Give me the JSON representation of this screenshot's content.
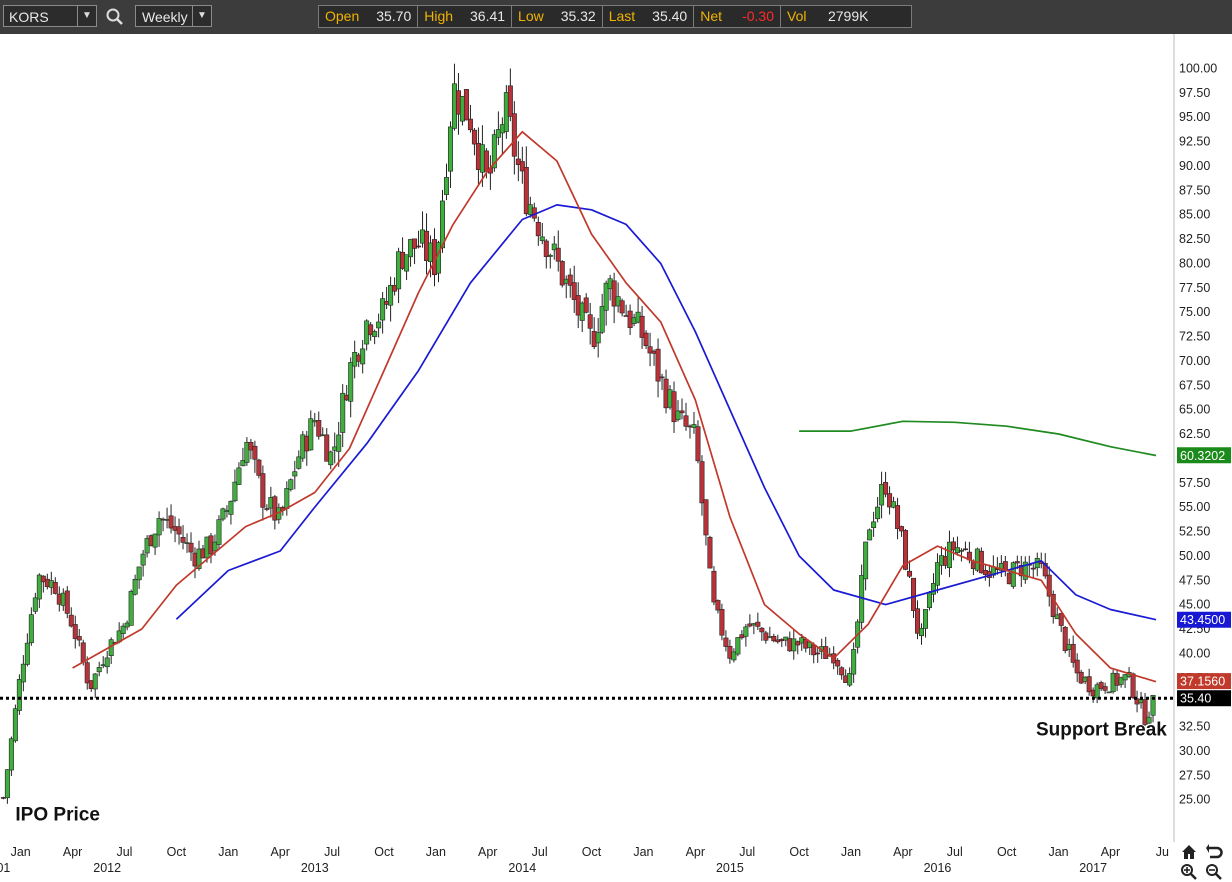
{
  "toolbar": {
    "symbol": "KORS",
    "interval": "Weekly",
    "quote": [
      {
        "label": "Open",
        "value": "35.70"
      },
      {
        "label": "High",
        "value": "36.41"
      },
      {
        "label": "Low",
        "value": "35.32"
      },
      {
        "label": "Last",
        "value": "35.40"
      },
      {
        "label": "Net",
        "value": "-0.30"
      },
      {
        "label": "Vol",
        "value": "2799K"
      }
    ],
    "net_color": "#ff2b2b"
  },
  "chart_data": {
    "type": "candlestick",
    "title": "",
    "ylim": [
      22.5,
      102.5
    ],
    "y_ticks": [
      "25.00",
      "27.50",
      "30.00",
      "32.50",
      "35.00",
      "37.50",
      "40.00",
      "42.50",
      "45.00",
      "47.50",
      "50.00",
      "52.50",
      "55.00",
      "57.50",
      "60.00",
      "62.50",
      "65.00",
      "67.50",
      "70.00",
      "72.50",
      "75.00",
      "77.50",
      "80.00",
      "82.50",
      "85.00",
      "87.50",
      "90.00",
      "92.50",
      "95.00",
      "97.50",
      "100.00"
    ],
    "x_axis_labels": [
      {
        "text": "Jan",
        "x": "2012-01"
      },
      {
        "text": "Apr",
        "x": "2012-04"
      },
      {
        "text": "Jul",
        "x": "2012-07"
      },
      {
        "text": "Oct",
        "x": "2012-10"
      },
      {
        "text": "Jan",
        "x": "2013-01"
      },
      {
        "text": "Apr",
        "x": "2013-04"
      },
      {
        "text": "Jul",
        "x": "2013-07"
      },
      {
        "text": "Oct",
        "x": "2013-10"
      },
      {
        "text": "Jan",
        "x": "2014-01"
      },
      {
        "text": "Apr",
        "x": "2014-04"
      },
      {
        "text": "Jul",
        "x": "2014-07"
      },
      {
        "text": "Oct",
        "x": "2014-10"
      },
      {
        "text": "Jan",
        "x": "2015-01"
      },
      {
        "text": "Apr",
        "x": "2015-04"
      },
      {
        "text": "Jul",
        "x": "2015-07"
      },
      {
        "text": "Oct",
        "x": "2015-10"
      },
      {
        "text": "Jan",
        "x": "2016-01"
      },
      {
        "text": "Apr",
        "x": "2016-04"
      },
      {
        "text": "Jul",
        "x": "2016-07"
      },
      {
        "text": "Oct",
        "x": "2016-10"
      },
      {
        "text": "Jan",
        "x": "2017-01"
      },
      {
        "text": "Apr",
        "x": "2017-04"
      },
      {
        "text": "Ju",
        "x": "2017-07"
      }
    ],
    "x_year_labels": [
      {
        "text": "01",
        "x": "2011-12"
      },
      {
        "text": "2012",
        "x": "2012-06"
      },
      {
        "text": "2013",
        "x": "2013-06"
      },
      {
        "text": "2014",
        "x": "2014-06"
      },
      {
        "text": "2015",
        "x": "2015-06"
      },
      {
        "text": "2016",
        "x": "2016-06"
      },
      {
        "text": "2017",
        "x": "2017-03"
      }
    ],
    "up_color": "#3fae3f",
    "down_color": "#b8323a",
    "price_path": [
      [
        "2011-12",
        25.2
      ],
      [
        "2012-01",
        38.0
      ],
      [
        "2012-02",
        48.0
      ],
      [
        "2012-03",
        47.0
      ],
      [
        "2012-04",
        43.0
      ],
      [
        "2012-05",
        36.5
      ],
      [
        "2012-06",
        40.5
      ],
      [
        "2012-07",
        43.0
      ],
      [
        "2012-08",
        50.0
      ],
      [
        "2012-09",
        54.0
      ],
      [
        "2012-10",
        52.5
      ],
      [
        "2012-11",
        50.0
      ],
      [
        "2012-12",
        51.0
      ],
      [
        "2013-01",
        55.0
      ],
      [
        "2013-02",
        62.0
      ],
      [
        "2013-03",
        56.0
      ],
      [
        "2013-04",
        53.5
      ],
      [
        "2013-05",
        60.0
      ],
      [
        "2013-06",
        64.0
      ],
      [
        "2013-07",
        60.0
      ],
      [
        "2013-08",
        69.0
      ],
      [
        "2013-09",
        74.0
      ],
      [
        "2013-10",
        75.0
      ],
      [
        "2013-11",
        81.0
      ],
      [
        "2013-12",
        82.0
      ],
      [
        "2014-01",
        80.0
      ],
      [
        "2014-02",
        98.0
      ],
      [
        "2014-03",
        95.0
      ],
      [
        "2014-04",
        88.0
      ],
      [
        "2014-05",
        96.0
      ],
      [
        "2014-06",
        88.0
      ],
      [
        "2014-07",
        84.0
      ],
      [
        "2014-08",
        80.0
      ],
      [
        "2014-09",
        76.0
      ],
      [
        "2014-10",
        72.0
      ],
      [
        "2014-11",
        78.0
      ],
      [
        "2014-12",
        75.0
      ],
      [
        "2015-01",
        72.5
      ],
      [
        "2015-02",
        68.0
      ],
      [
        "2015-03",
        64.0
      ],
      [
        "2015-04",
        62.0
      ],
      [
        "2015-05",
        45.0
      ],
      [
        "2015-06",
        40.0
      ],
      [
        "2015-07",
        43.0
      ],
      [
        "2015-08",
        42.0
      ],
      [
        "2015-09",
        41.0
      ],
      [
        "2015-10",
        41.0
      ],
      [
        "2015-11",
        40.0
      ],
      [
        "2015-12",
        40.0
      ],
      [
        "2016-01",
        37.0
      ],
      [
        "2016-02",
        53.0
      ],
      [
        "2016-03",
        57.5
      ],
      [
        "2016-04",
        51.0
      ],
      [
        "2016-05",
        41.0
      ],
      [
        "2016-06",
        49.0
      ],
      [
        "2016-07",
        51.0
      ],
      [
        "2016-08",
        50.0
      ],
      [
        "2016-09",
        48.5
      ],
      [
        "2016-10",
        48.0
      ],
      [
        "2016-11",
        49.0
      ],
      [
        "2016-12",
        48.5
      ],
      [
        "2017-01",
        43.0
      ],
      [
        "2017-02",
        38.0
      ],
      [
        "2017-03",
        36.5
      ],
      [
        "2017-04",
        37.0
      ],
      [
        "2017-05",
        37.5
      ],
      [
        "2017-06",
        33.5
      ],
      [
        "2017-06-20",
        35.4
      ]
    ],
    "ma_red": [
      [
        "2012-04",
        38.5
      ],
      [
        "2012-06",
        40.5
      ],
      [
        "2012-08",
        42.5
      ],
      [
        "2012-10",
        47.0
      ],
      [
        "2012-12",
        50.0
      ],
      [
        "2013-02",
        53.0
      ],
      [
        "2013-04",
        54.5
      ],
      [
        "2013-06",
        56.5
      ],
      [
        "2013-08",
        61.0
      ],
      [
        "2013-10",
        69.0
      ],
      [
        "2013-12",
        77.0
      ],
      [
        "2014-02",
        84.0
      ],
      [
        "2014-04",
        89.5
      ],
      [
        "2014-06",
        93.5
      ],
      [
        "2014-08",
        90.5
      ],
      [
        "2014-10",
        83.0
      ],
      [
        "2014-12",
        78.0
      ],
      [
        "2015-02",
        74.0
      ],
      [
        "2015-04",
        66.0
      ],
      [
        "2015-06",
        54.0
      ],
      [
        "2015-08",
        45.0
      ],
      [
        "2015-10",
        42.0
      ],
      [
        "2015-12",
        39.5
      ],
      [
        "2016-02",
        43.0
      ],
      [
        "2016-04",
        49.0
      ],
      [
        "2016-06",
        51.0
      ],
      [
        "2016-08",
        49.5
      ],
      [
        "2016-10",
        48.5
      ],
      [
        "2016-12",
        47.5
      ],
      [
        "2017-02",
        42.0
      ],
      [
        "2017-04",
        38.5
      ],
      [
        "2017-06-20",
        37.1
      ]
    ],
    "ma_blue": [
      [
        "2012-10",
        43.5
      ],
      [
        "2013-01",
        48.5
      ],
      [
        "2013-04",
        50.5
      ],
      [
        "2013-06",
        55.0
      ],
      [
        "2013-09",
        61.5
      ],
      [
        "2013-12",
        69.0
      ],
      [
        "2014-03",
        78.0
      ],
      [
        "2014-06",
        84.5
      ],
      [
        "2014-08",
        86.0
      ],
      [
        "2014-10",
        85.5
      ],
      [
        "2014-12",
        84.0
      ],
      [
        "2015-02",
        80.0
      ],
      [
        "2015-04",
        73.0
      ],
      [
        "2015-06",
        65.0
      ],
      [
        "2015-08",
        57.0
      ],
      [
        "2015-10",
        50.0
      ],
      [
        "2015-12",
        46.5
      ],
      [
        "2016-03",
        45.0
      ],
      [
        "2016-06",
        46.5
      ],
      [
        "2016-09",
        48.0
      ],
      [
        "2016-12",
        49.5
      ],
      [
        "2017-02",
        46.0
      ],
      [
        "2017-04",
        44.5
      ],
      [
        "2017-06-20",
        43.45
      ]
    ],
    "ma_green": [
      [
        "2015-10",
        62.8
      ],
      [
        "2016-01",
        62.8
      ],
      [
        "2016-04",
        63.8
      ],
      [
        "2016-07",
        63.7
      ],
      [
        "2016-10",
        63.3
      ],
      [
        "2017-01",
        62.5
      ],
      [
        "2017-04",
        61.2
      ],
      [
        "2017-06-20",
        60.3
      ]
    ],
    "support_level": 35.4,
    "price_tags": [
      {
        "text": "60.3202",
        "y": 60.3202,
        "color": "#1a8a1a"
      },
      {
        "text": "43.4500",
        "y": 43.45,
        "color": "#1717d4"
      },
      {
        "text": "37.1560",
        "y": 37.156,
        "color": "#c0392b"
      },
      {
        "text": "35.40",
        "y": 35.4,
        "color": "#000000"
      }
    ],
    "annotations": [
      {
        "text": "IPO Price",
        "x": "2011-12",
        "y": 23.5
      },
      {
        "text": "Support Break",
        "x": "2016-11",
        "y": 32.2
      }
    ]
  },
  "nav_icons": [
    "home-icon",
    "redo-icon",
    "zoom-in-icon",
    "zoom-out-icon"
  ]
}
